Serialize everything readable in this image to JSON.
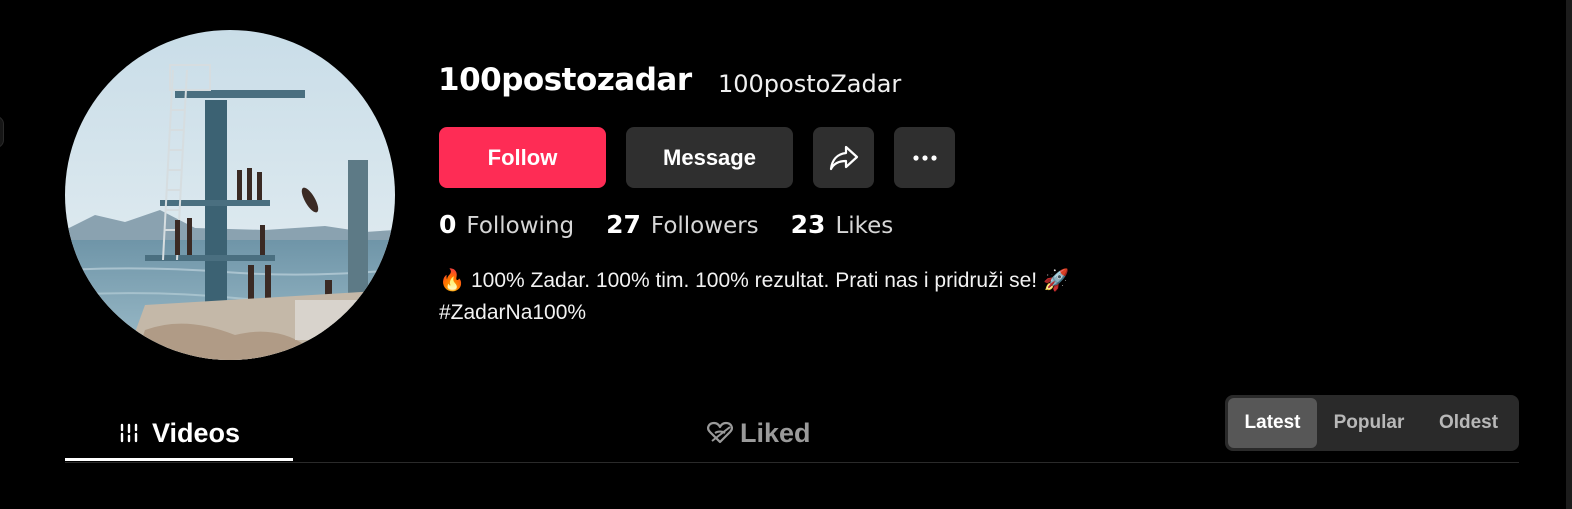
{
  "profile": {
    "username": "100postozadar",
    "nickname": "100postoZadar"
  },
  "actions": {
    "follow_label": "Follow",
    "message_label": "Message",
    "share_icon": "share-icon",
    "more_icon": "more-icon"
  },
  "stats": [
    {
      "value": "0",
      "label": "Following"
    },
    {
      "value": "27",
      "label": "Followers"
    },
    {
      "value": "23",
      "label": "Likes"
    }
  ],
  "bio": {
    "line1_emoji_start": "🔥",
    "line1_text": " 100% Zadar. 100% tim. 100% rezultat. Prati nas i pridruži se! ",
    "line1_emoji_end": "🚀",
    "line2": "#ZadarNa100%"
  },
  "tabs": {
    "videos": "Videos",
    "liked": "Liked"
  },
  "sort": {
    "options": [
      "Latest",
      "Popular",
      "Oldest"
    ],
    "selected": "Latest"
  },
  "colors": {
    "accent": "#fe2c55",
    "background": "#000000",
    "button_dark": "#2f2f2f"
  }
}
